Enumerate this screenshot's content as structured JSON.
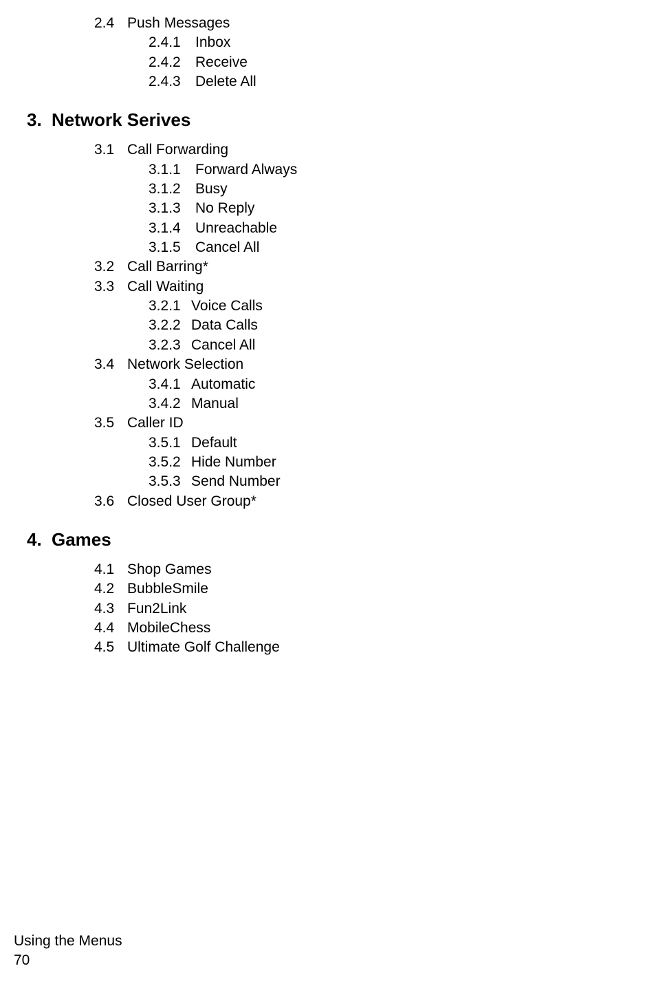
{
  "section2_4": {
    "num": "2.4",
    "title": "Push Messages",
    "items": [
      {
        "num": "2.4.1",
        "title": "Inbox"
      },
      {
        "num": "2.4.2",
        "title": "Receive"
      },
      {
        "num": "2.4.3",
        "title": "Delete All"
      }
    ]
  },
  "heading3": {
    "num": "3.",
    "title": "Network Serives"
  },
  "section3": {
    "items": [
      {
        "num": "3.1",
        "title": "Call Forwarding",
        "sub": [
          {
            "num": "3.1.1",
            "title": "Forward Always"
          },
          {
            "num": "3.1.2",
            "title": "Busy"
          },
          {
            "num": "3.1.3",
            "title": "No Reply"
          },
          {
            "num": "3.1.4",
            "title": "Unreachable"
          },
          {
            "num": "3.1.5",
            "title": "Cancel All"
          }
        ]
      },
      {
        "num": "3.2",
        "title": "Call Barring*"
      },
      {
        "num": "3.3",
        "title": "Call Waiting",
        "sub": [
          {
            "num": "3.2.1",
            "title": "Voice Calls"
          },
          {
            "num": "3.2.2",
            "title": "Data Calls"
          },
          {
            "num": "3.2.3",
            "title": "Cancel All"
          }
        ]
      },
      {
        "num": "3.4",
        "title": "Network Selection",
        "sub": [
          {
            "num": "3.4.1",
            "title": "Automatic"
          },
          {
            "num": "3.4.2",
            "title": "Manual"
          }
        ]
      },
      {
        "num": "3.5",
        "title": "Caller ID",
        "sub": [
          {
            "num": "3.5.1",
            "title": "Default"
          },
          {
            "num": "3.5.2",
            "title": "Hide Number"
          },
          {
            "num": "3.5.3",
            "title": "Send Number"
          }
        ]
      },
      {
        "num": "3.6",
        "title": "Closed User Group*"
      }
    ]
  },
  "heading4": {
    "num": "4.",
    "title": "Games"
  },
  "section4": {
    "items": [
      {
        "num": "4.1",
        "title": "Shop Games"
      },
      {
        "num": "4.2",
        "title": "BubbleSmile"
      },
      {
        "num": "4.3",
        "title": "Fun2Link"
      },
      {
        "num": "4.4",
        "title": "MobileChess"
      },
      {
        "num": "4.5",
        "title": "Ultimate Golf Challenge"
      }
    ]
  },
  "footer": {
    "title": "Using the Menus",
    "page": "70"
  }
}
